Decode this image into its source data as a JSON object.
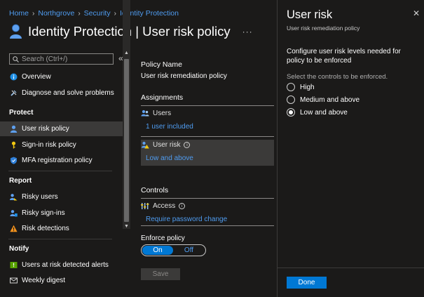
{
  "breadcrumb": [
    "Home",
    "Northgrove",
    "Security",
    "Identity Protection"
  ],
  "page": {
    "title": "Identity Protection | User risk policy",
    "more": "···"
  },
  "nav": {
    "search_placeholder": "Search (Ctrl+/)",
    "collapse": "«",
    "items_top": [
      {
        "label": "Overview",
        "icon": "info-icon"
      },
      {
        "label": "Diagnose and solve problems",
        "icon": "wrench-icon"
      }
    ],
    "section_protect": "Protect",
    "items_protect": [
      {
        "label": "User risk policy",
        "icon": "user-icon",
        "active": true
      },
      {
        "label": "Sign-in risk policy",
        "icon": "key-icon"
      },
      {
        "label": "MFA registration policy",
        "icon": "shield-icon"
      }
    ],
    "section_report": "Report",
    "items_report": [
      {
        "label": "Risky users",
        "icon": "users-icon"
      },
      {
        "label": "Risky sign-ins",
        "icon": "signin-icon"
      },
      {
        "label": "Risk detections",
        "icon": "warning-icon"
      }
    ],
    "section_notify": "Notify",
    "items_notify": [
      {
        "label": "Users at risk detected alerts",
        "icon": "alert-icon"
      },
      {
        "label": "Weekly digest",
        "icon": "mail-icon"
      }
    ]
  },
  "policy": {
    "name_label": "Policy Name",
    "name_value": "User risk remediation policy",
    "assignments_label": "Assignments",
    "users_label": "Users",
    "users_value": "1 user included",
    "user_risk_label": "User risk",
    "user_risk_value": "Low and above",
    "controls_label": "Controls",
    "access_label": "Access",
    "access_value": "Require password change",
    "enforce_label": "Enforce policy",
    "toggle_on": "On",
    "toggle_off": "Off",
    "save_label": "Save"
  },
  "blade": {
    "title": "User risk",
    "subtitle": "User risk remediation policy",
    "close": "✕",
    "description": "Configure user risk levels needed for policy to be enforced",
    "select_label": "Select the controls to be enforced.",
    "options": [
      {
        "label": "High",
        "selected": false
      },
      {
        "label": "Medium and above",
        "selected": false
      },
      {
        "label": "Low and above",
        "selected": true
      }
    ],
    "done_label": "Done"
  },
  "colors": {
    "accent": "#0078d4",
    "link": "#4f9cf0",
    "background": "#1b1a19"
  }
}
